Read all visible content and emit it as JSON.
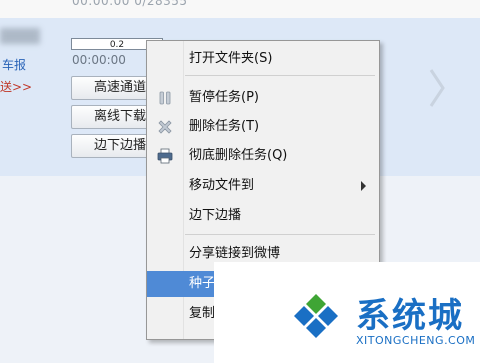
{
  "task": {
    "top_time": "00:00:00    0/28355",
    "ad_label": "车报",
    "send_label": "送>>",
    "progress_text": "0.2",
    "time": "00:00:00",
    "buttons": [
      "高速通道",
      "离线下载",
      "边下边播"
    ]
  },
  "context_menu": {
    "items": [
      {
        "label": "打开文件夹(S)",
        "icon": ""
      },
      {
        "label": "暂停任务(P)",
        "icon": "pause-icon"
      },
      {
        "label": "删除任务(T)",
        "icon": "delete-x-icon"
      },
      {
        "label": "彻底删除任务(Q)",
        "icon": "printer-icon"
      },
      {
        "label": "移动文件到",
        "icon": "",
        "submenu": true
      },
      {
        "label": "边下边播",
        "icon": ""
      },
      {
        "label": "分享链接到微博",
        "icon": ""
      },
      {
        "label": "种子",
        "icon": "",
        "selected": true
      },
      {
        "label": "复制",
        "icon": ""
      }
    ]
  },
  "watermark": {
    "name": "系统城",
    "url": "XITONGCHENG.COM",
    "colors": {
      "blue": "#1a6fc4",
      "green": "#3fa535"
    }
  }
}
